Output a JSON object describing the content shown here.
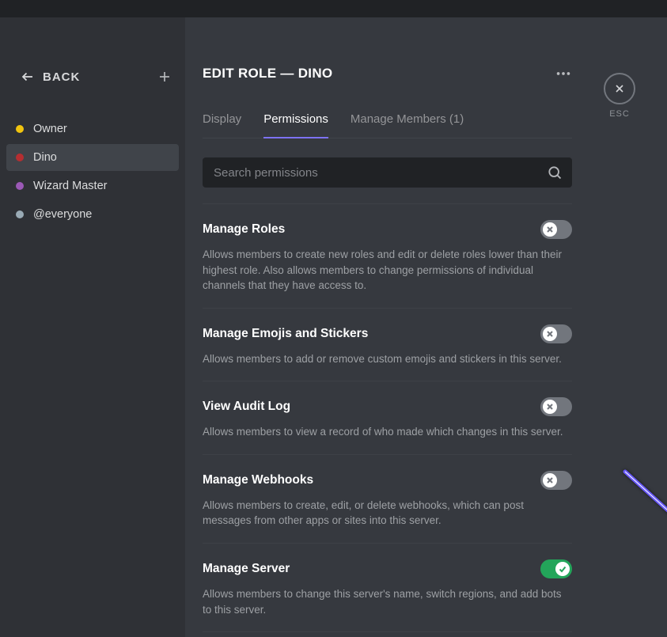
{
  "back_label": "BACK",
  "esc_label": "ESC",
  "title": "EDIT ROLE — DINO",
  "roles": [
    {
      "name": "Owner",
      "color": "#f1c40f",
      "selected": false
    },
    {
      "name": "Dino",
      "color": "#b52e31",
      "selected": true
    },
    {
      "name": "Wizard Master",
      "color": "#9b59b6",
      "selected": false
    },
    {
      "name": "@everyone",
      "color": "#99aab5",
      "selected": false
    }
  ],
  "tabs": [
    {
      "label": "Display",
      "active": false
    },
    {
      "label": "Permissions",
      "active": true
    },
    {
      "label": "Manage Members (1)",
      "active": false
    }
  ],
  "search_placeholder": "Search permissions",
  "permissions": [
    {
      "title": "Manage Roles",
      "desc": "Allows members to create new roles and edit or delete roles lower than their highest role. Also allows members to change permissions of individual channels that they have access to.",
      "on": false
    },
    {
      "title": "Manage Emojis and Stickers",
      "desc": "Allows members to add or remove custom emojis and stickers in this server.",
      "on": false
    },
    {
      "title": "View Audit Log",
      "desc": "Allows members to view a record of who made which changes in this server.",
      "on": false
    },
    {
      "title": "Manage Webhooks",
      "desc": "Allows members to create, edit, or delete webhooks, which can post messages from other apps or sites into this server.",
      "on": false
    },
    {
      "title": "Manage Server",
      "desc": "Allows members to change this server's name, switch regions, and add bots to this server.",
      "on": true
    }
  ]
}
